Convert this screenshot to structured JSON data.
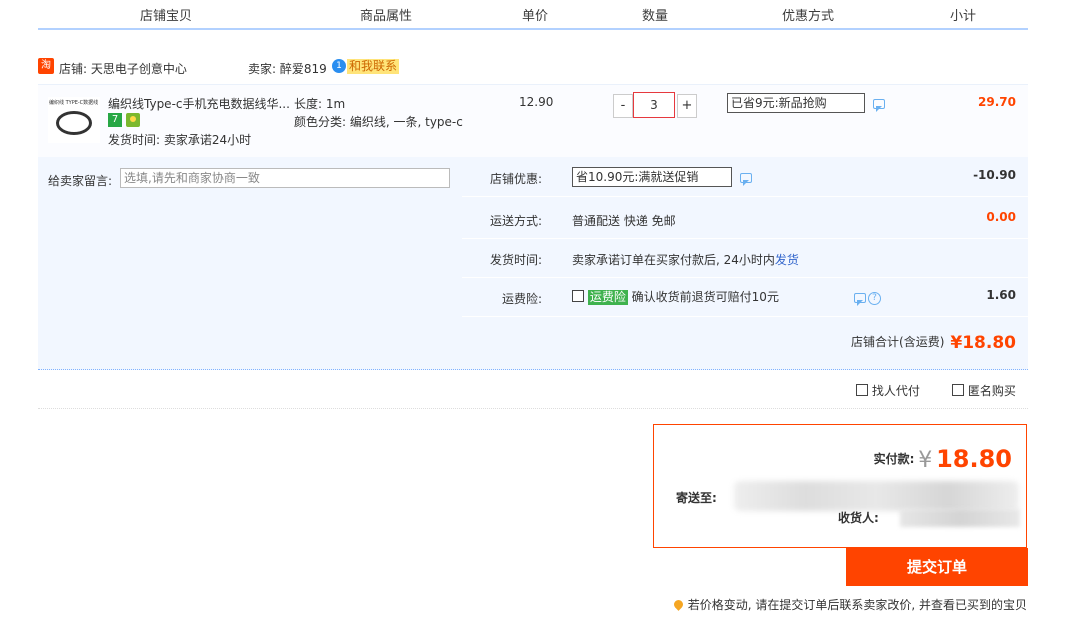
{
  "header": {
    "col_shop_item": "店铺宝贝",
    "col_attrs": "商品属性",
    "col_price": "单价",
    "col_qty": "数量",
    "col_discount": "优惠方式",
    "col_subtotal": "小计"
  },
  "shop": {
    "tao_icon": "淘",
    "shop_name": "店铺: 天思电子创意中心",
    "seller": "卖家: 醉爱819",
    "contact_label": "和我联系"
  },
  "item": {
    "thumb_caption": "编织线 TYPE-C数据线",
    "title": "编织线Type-c手机充电数据线华...",
    "badge_7": "7",
    "ship_time": "发货时间: 卖家承诺24小时",
    "attr_length": "长度: 1m",
    "attr_color": "颜色分类: 编织线, 一条, type-c",
    "price": "12.90",
    "qty_minus": "-",
    "qty_value": "3",
    "qty_plus": "+",
    "discount": "已省9元:新品抢购",
    "subtotal": "29.70"
  },
  "extras": {
    "memo_label": "给卖家留言:",
    "memo_placeholder": "选填,请先和商家协商一致",
    "shop_promo_label": "店铺优惠:",
    "shop_promo_value": "省10.90元:满就送促销",
    "shop_promo_amount": "-10.90",
    "shipping_label": "运送方式:",
    "shipping_value": "普通配送 快递 免邮",
    "shipping_amount": "0.00",
    "dispatch_label": "发货时间:",
    "dispatch_value": "卖家承诺订单在买家付款后, 24小时内",
    "dispatch_link": "发货",
    "insurance_label": "运费险:",
    "insurance_badge": "运费险",
    "insurance_text": "确认收货前退货可赔付10元",
    "insurance_amount": "1.60",
    "shop_total_label": "店铺合计(含运费)",
    "shop_total_value": "¥18.80"
  },
  "options": {
    "proxy_pay": "找人代付",
    "anonymous": "匿名购买"
  },
  "payment": {
    "paid_label": "实付款:",
    "currency": "¥",
    "paid_value": "18.80",
    "address_label": "寄送至:",
    "receiver_label": "收货人:"
  },
  "submit_label": "提交订单",
  "notice": "若价格变动, 请在提交订单后联系卖家改价, 并查看已买到的宝贝",
  "colors": {
    "accent": "#ff4400",
    "header_border": "#b2d1ff",
    "panel_bg": "#f2f7ff"
  }
}
